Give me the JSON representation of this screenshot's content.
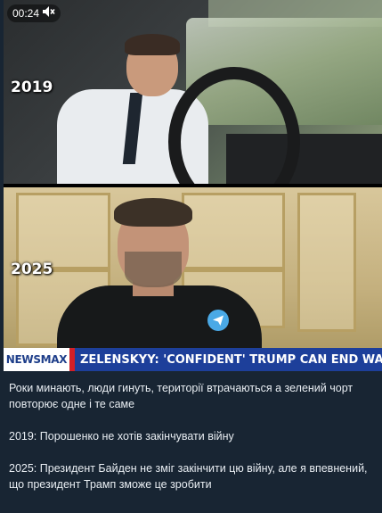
{
  "video": {
    "timestamp": "00:24",
    "mute_icon": "speaker-muted-icon",
    "play_icon": "telegram-share-icon",
    "accent_color": "#4aa9e6",
    "top_year": "2019",
    "bottom_year": "2025",
    "ticker": {
      "brand": "NEWSMAX",
      "headline": "ZELENSKYY: 'CONFIDENT' TRUMP CAN END WAR",
      "brand_color": "#1e3e8a",
      "bar_color": "#1d3f9a",
      "stripe_color": "#d41f26"
    }
  },
  "caption": {
    "line1": "Роки минають, люди гинуть, території втрачаються а зелений чорт повторює одне і те саме",
    "line2": "2019: Порошенко не хотів закінчувати війну",
    "line3a": "2025: Президент Байден не зміг закінчити цю війну, але я впевнений,",
    "line3b": "що президент Трамп зможе це зробити"
  }
}
